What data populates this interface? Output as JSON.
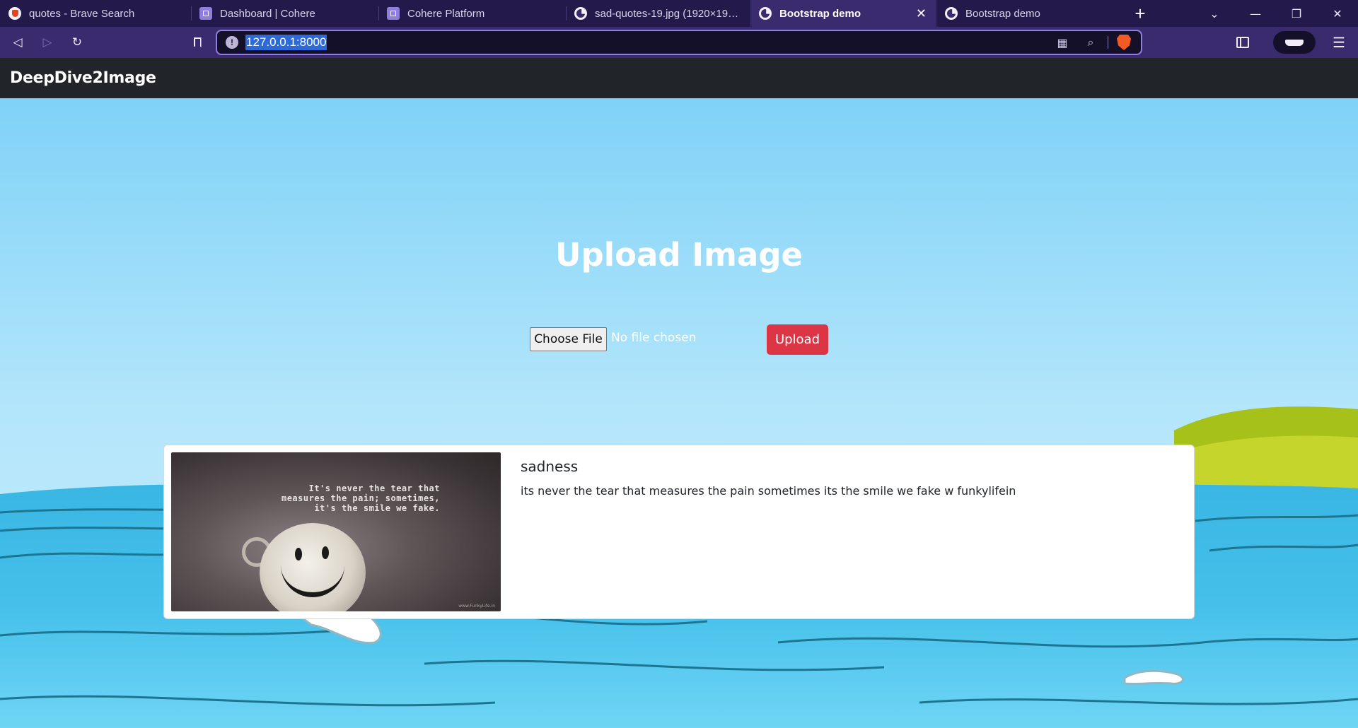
{
  "browser": {
    "tabs": [
      {
        "label": "quotes - Brave Search",
        "icon": "brave-icon"
      },
      {
        "label": "Dashboard | Cohere",
        "icon": "cohere-icon"
      },
      {
        "label": "Cohere Platform",
        "icon": "cohere-icon"
      },
      {
        "label": "sad-quotes-19.jpg (1920×1920)",
        "icon": "globe-icon"
      },
      {
        "label": "Bootstrap demo",
        "icon": "globe-icon",
        "active": true
      },
      {
        "label": "Bootstrap demo",
        "icon": "globe-icon"
      }
    ],
    "new_tab": "+",
    "url": "127.0.0.1:8000",
    "accent": "#3a2a6e",
    "url_border": "#8f7fe0"
  },
  "navbar": {
    "brand": "DeepDive2Image"
  },
  "upload": {
    "heading": "Upload Image",
    "choose_label": "Choose File",
    "no_file_label": "No file chosen",
    "submit_label": "Upload",
    "submit_color": "#dc3545"
  },
  "result_card": {
    "image_quote": [
      "It's never the tear that",
      "measures the pain; sometimes,",
      "it's the smile we fake."
    ],
    "image_watermark": "www.FunkyLife.in",
    "title": "sadness",
    "text": "its never the tear that measures the pain sometimes its the smile we fake w funkylifein"
  }
}
